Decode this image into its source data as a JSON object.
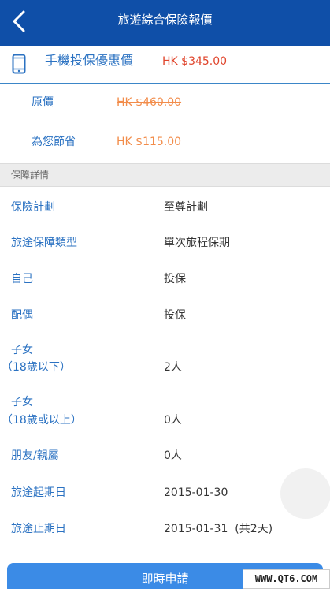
{
  "header": {
    "title": "旅遊綜合保險報價",
    "back_icon": "chevron-left-icon"
  },
  "offer": {
    "icon": "smartphone-icon",
    "label": "手機投保優惠價",
    "price": "HK $345.00"
  },
  "original": {
    "label": "原價",
    "value": "HK $460.00"
  },
  "savings": {
    "label": "為您節省",
    "value": "HK $115.00"
  },
  "section": {
    "title": "保障詳情"
  },
  "details": [
    {
      "label": "保險計劃",
      "value": "至尊計劃"
    },
    {
      "label": "旅途保障類型",
      "value": "單次旅程保期"
    },
    {
      "label": "自己",
      "value": "投保"
    },
    {
      "label": "配偶",
      "value": "投保"
    },
    {
      "label": "子女",
      "sublabel": "（18歲以下）",
      "value": "2人"
    },
    {
      "label": "子女",
      "sublabel": "（18歲或以上）",
      "value": "0人"
    },
    {
      "label": "朋友/親屬",
      "value": "0人"
    },
    {
      "label": "旅途起期日",
      "value": "2015-01-30"
    },
    {
      "label": "旅途止期日",
      "value": "2015-01-31  (共2天)"
    }
  ],
  "apply_button": {
    "label": "即時申請"
  },
  "watermark": {
    "text": "WWW.QT6.COM"
  },
  "colors": {
    "header_bg": "#0f4fa8",
    "label_blue": "#2b72c2",
    "price_red": "#e0452c",
    "price_orange": "#f28c4a",
    "button_blue": "#3b8be6"
  }
}
